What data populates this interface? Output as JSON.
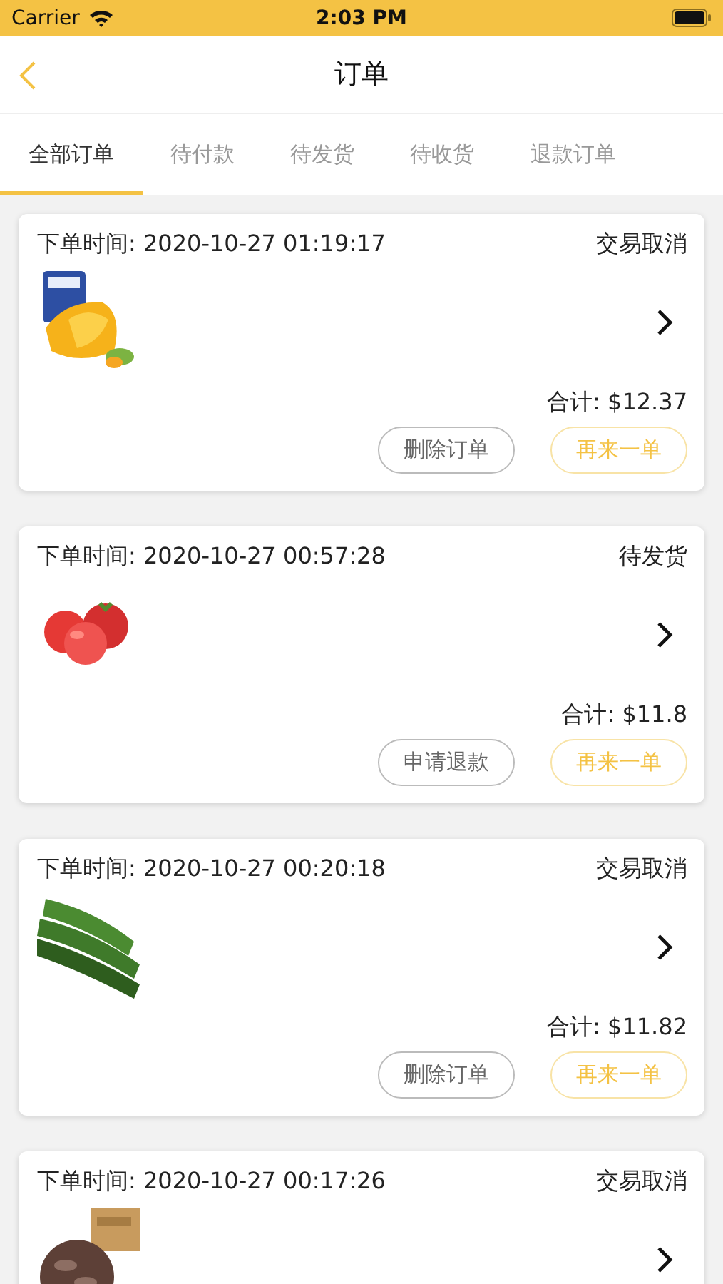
{
  "status_bar": {
    "carrier": "Carrier",
    "time": "2:03 PM"
  },
  "nav": {
    "title": "订单"
  },
  "tabs": [
    {
      "label": "全部订单",
      "selected": true
    },
    {
      "label": "待付款",
      "selected": false
    },
    {
      "label": "待发货",
      "selected": false
    },
    {
      "label": "待收货",
      "selected": false
    },
    {
      "label": "退款订单",
      "selected": false
    }
  ],
  "orders": [
    {
      "time": "下单时间: 2020-10-27 01:19:17",
      "status": "交易取消",
      "total": "合计: $12.37",
      "buttons": [
        {
          "label": "删除订单",
          "kind": "secondary"
        },
        {
          "label": "再来一单",
          "kind": "primary"
        }
      ]
    },
    {
      "time": "下单时间: 2020-10-27 00:57:28",
      "status": "待发货",
      "total": "合计: $11.8",
      "buttons": [
        {
          "label": "申请退款",
          "kind": "secondary"
        },
        {
          "label": "再来一单",
          "kind": "primary"
        }
      ]
    },
    {
      "time": "下单时间: 2020-10-27 00:20:18",
      "status": "交易取消",
      "total": "合计: $11.82",
      "buttons": [
        {
          "label": "删除订单",
          "kind": "secondary"
        },
        {
          "label": "再来一单",
          "kind": "primary"
        }
      ]
    },
    {
      "time": "下单时间: 2020-10-27 00:17:26",
      "status": "交易取消"
    }
  ]
}
